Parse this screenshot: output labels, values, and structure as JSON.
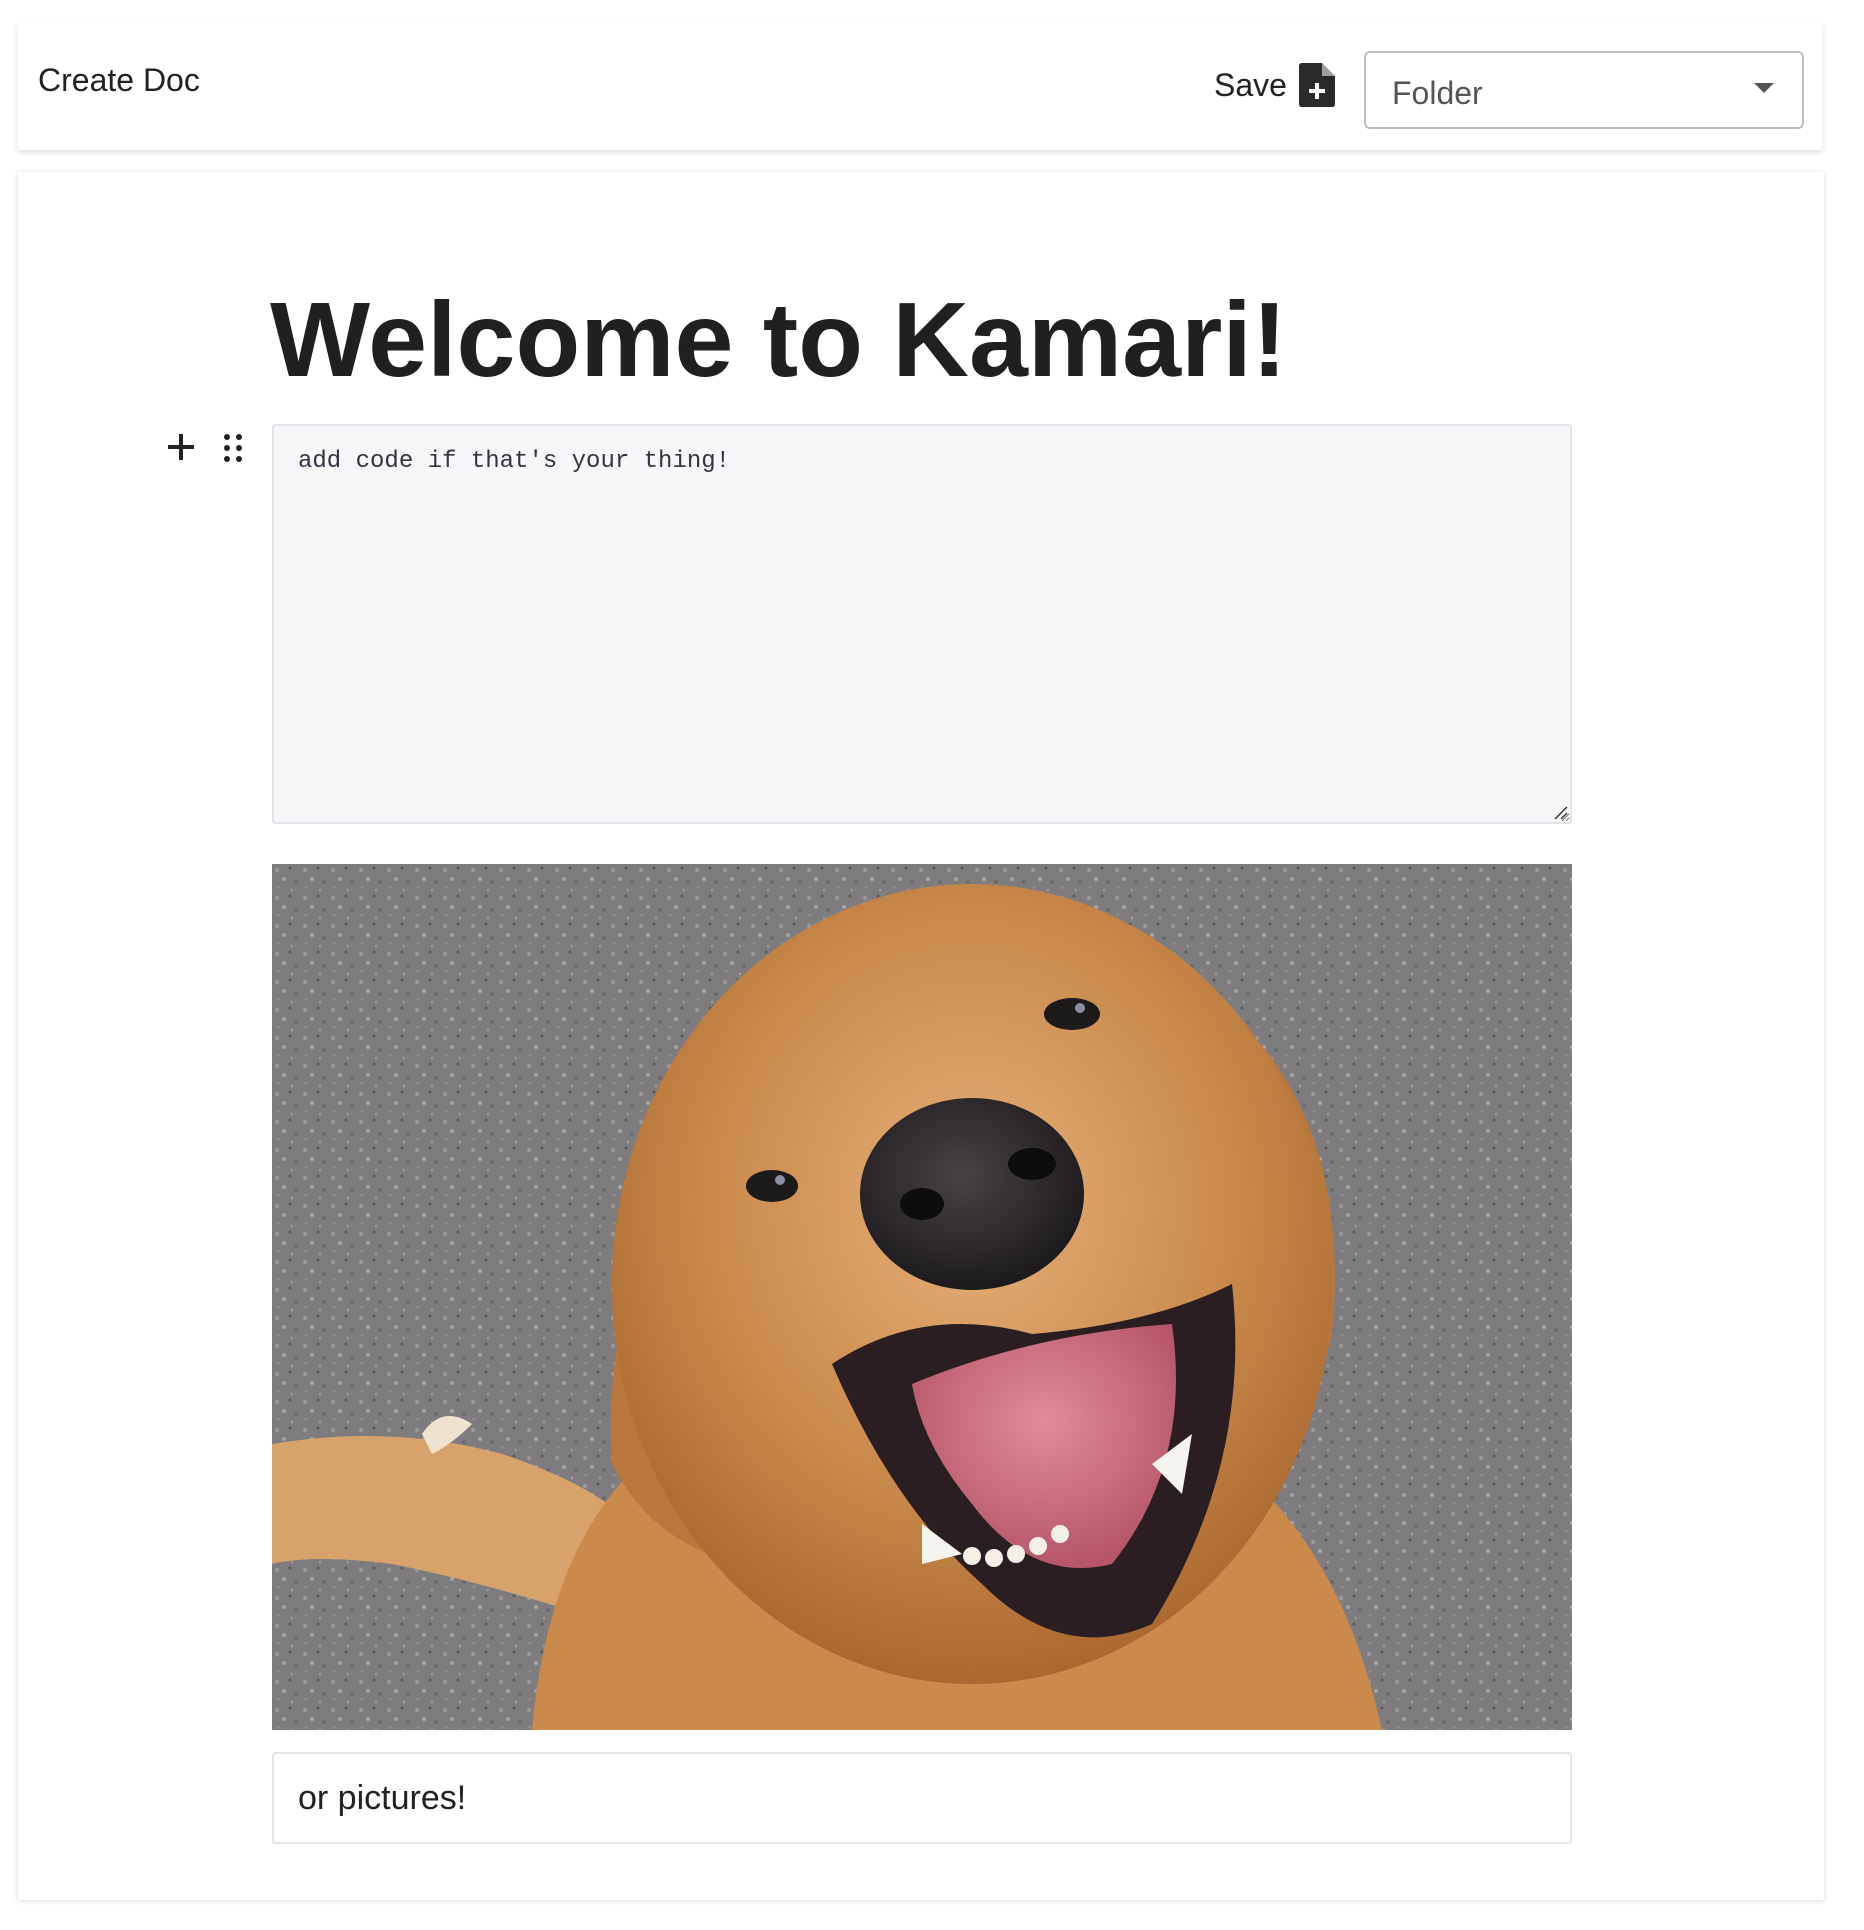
{
  "topbar": {
    "title": "Create Doc",
    "save_label": "Save",
    "save_icon": "file-plus-icon",
    "folder_select": {
      "selected_value": "Folder"
    }
  },
  "document": {
    "title": "Welcome to Kamari!",
    "code_block": {
      "value": "add code if that's your thing!"
    },
    "image": {
      "subject": "golden retriever smiling, looking up"
    },
    "caption": {
      "value": "or pictures!"
    }
  },
  "colors": {
    "code_bg": "#f7f7f9",
    "title_text": "#202020",
    "dog_fur": "#c98a4b",
    "gravel": "#7d7b7c"
  }
}
